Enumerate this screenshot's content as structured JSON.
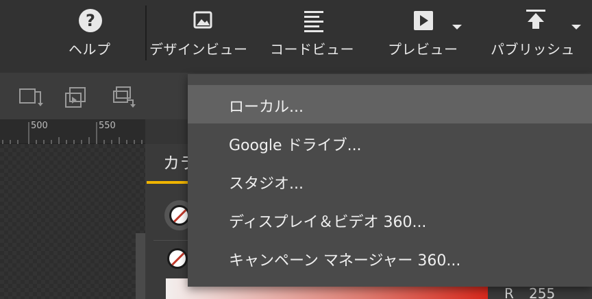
{
  "toolbar": {
    "help": {
      "label": "ヘルプ",
      "icon": "help-circle-icon"
    },
    "design_view": {
      "label": "デザインビュー",
      "icon": "image-icon"
    },
    "code_view": {
      "label": "コードビュー",
      "icon": "code-lines-icon"
    },
    "preview": {
      "label": "プレビュー",
      "icon": "play-icon"
    },
    "publish": {
      "label": "パブリッシュ",
      "icon": "upload-icon"
    }
  },
  "subbar": {
    "icons": [
      "layer-move-icon",
      "layer-duplicate-icon",
      "layer-stack-icon"
    ]
  },
  "ruler": {
    "ticks": [
      "500",
      "550"
    ]
  },
  "panel": {
    "tab_label": "カラ",
    "rgb": {
      "label": "R",
      "value": "255"
    },
    "accent_color": "#f0b400"
  },
  "publish_menu": {
    "items": [
      {
        "label": "ローカル...",
        "highlighted": true
      },
      {
        "label": "Google ドライブ...",
        "highlighted": false
      },
      {
        "label": "スタジオ...",
        "highlighted": false
      },
      {
        "label": "ディスプレイ＆ビデオ 360...",
        "highlighted": false
      },
      {
        "label": "キャンペーン マネージャー 360...",
        "highlighted": false
      }
    ]
  }
}
